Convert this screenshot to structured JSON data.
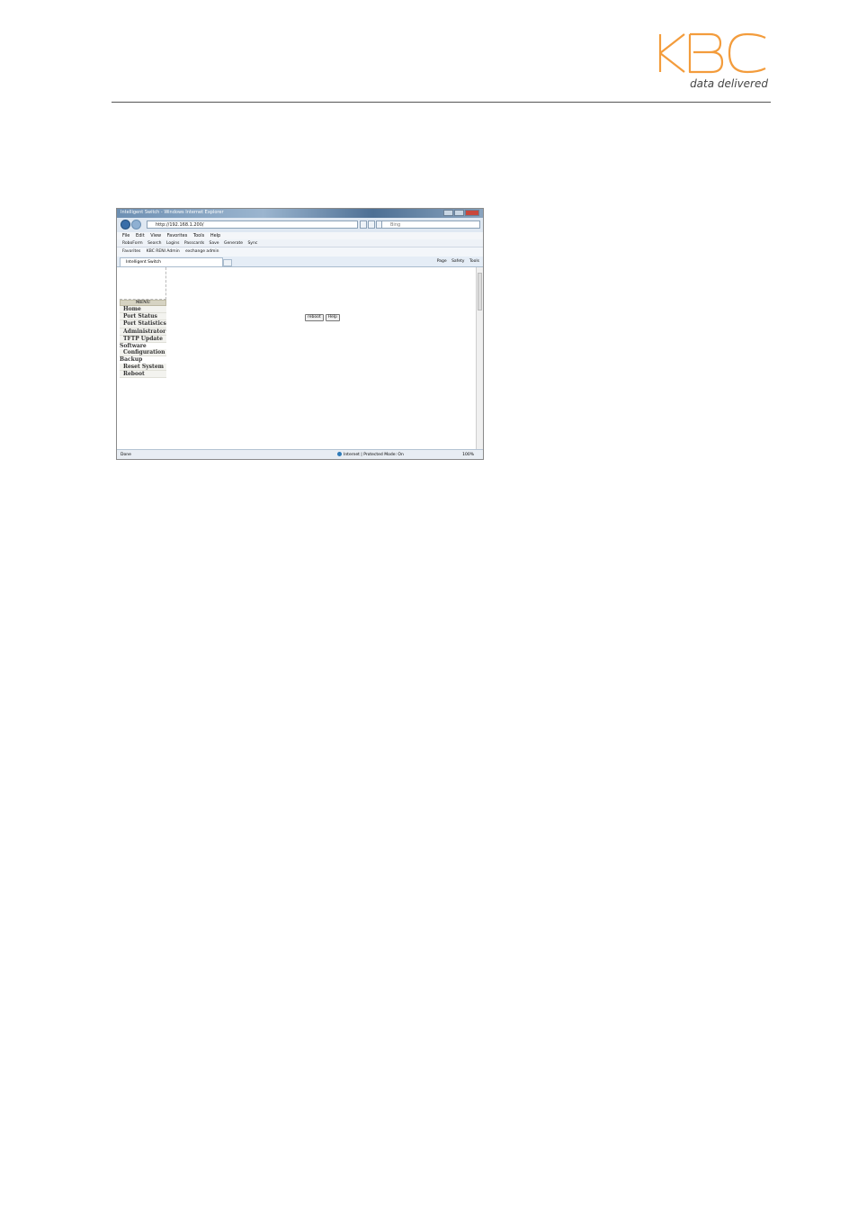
{
  "logo": {
    "text": "KBC",
    "tagline": "data delivered",
    "color": "#f39c3c"
  },
  "screenshot": {
    "window_title": "Intelligent Switch - Windows Internet Explorer",
    "url": "http://192.168.1.200/",
    "search_placeholder": "Bing",
    "menubar": [
      "File",
      "Edit",
      "View",
      "Favorites",
      "Tools",
      "Help"
    ],
    "toolbar": [
      "RoboForm",
      "Search",
      "Logins",
      "Passcards",
      "Save",
      "Generate",
      "Sync"
    ],
    "favorites": [
      "Favorites",
      "KBC RENI Admin",
      "exchange admin"
    ],
    "tab_title": "Intelligent Switch",
    "command_bar": [
      "Page",
      "Safety",
      "Tools"
    ],
    "menu_header": "MENU",
    "menu_items": [
      "Home",
      "Port Status",
      "Port Statistics",
      "Administrator",
      "TFTP Update",
      "Software",
      "Configuration",
      "Backup",
      "Reset System",
      "Reboot"
    ],
    "buttons": [
      "reboot",
      "Help"
    ],
    "status_left": "Done",
    "status_zone": "Internet | Protected Mode: On",
    "zoom": "100%"
  }
}
